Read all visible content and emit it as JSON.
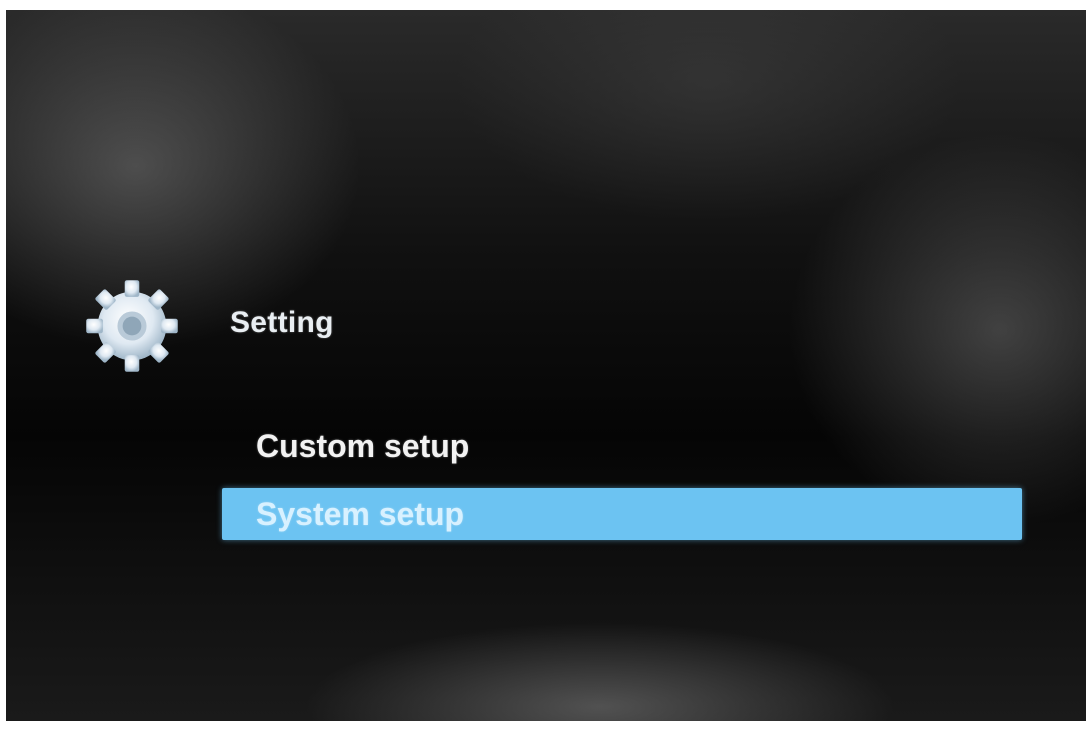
{
  "screen": {
    "icon": "gear-icon",
    "title": "Setting"
  },
  "menu": {
    "items": [
      {
        "label": "Custom setup",
        "selected": false
      },
      {
        "label": "System setup",
        "selected": true
      }
    ]
  },
  "colors": {
    "selection_highlight": "#6cc3f2",
    "text": "#f2f2f2",
    "background": "#0a0a0a"
  }
}
